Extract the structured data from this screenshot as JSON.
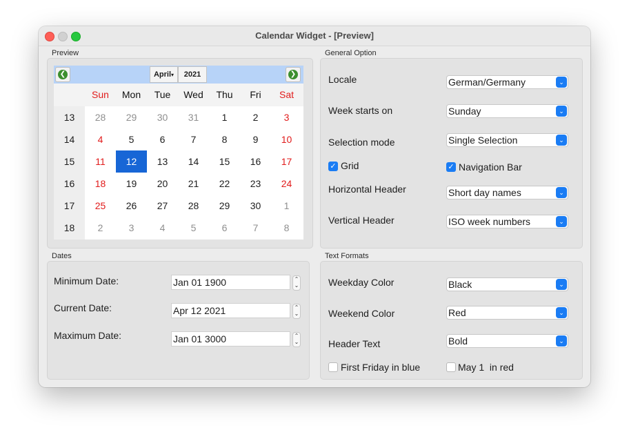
{
  "window": {
    "title": "Calendar Widget - [Preview]"
  },
  "preview": {
    "group_title": "Preview",
    "month": "April",
    "year": "2021",
    "day_headers": [
      {
        "label": "Sun",
        "weekend": true
      },
      {
        "label": "Mon",
        "weekend": false
      },
      {
        "label": "Tue",
        "weekend": false
      },
      {
        "label": "Wed",
        "weekend": false
      },
      {
        "label": "Thu",
        "weekend": false
      },
      {
        "label": "Fri",
        "weekend": false
      },
      {
        "label": "Sat",
        "weekend": true
      }
    ],
    "weeks": [
      {
        "week": "13",
        "days": [
          {
            "d": "28",
            "other": true
          },
          {
            "d": "29",
            "other": true
          },
          {
            "d": "30",
            "other": true
          },
          {
            "d": "31",
            "other": true
          },
          {
            "d": "1"
          },
          {
            "d": "2"
          },
          {
            "d": "3",
            "red": true
          }
        ]
      },
      {
        "week": "14",
        "days": [
          {
            "d": "4",
            "red": true
          },
          {
            "d": "5"
          },
          {
            "d": "6"
          },
          {
            "d": "7"
          },
          {
            "d": "8"
          },
          {
            "d": "9"
          },
          {
            "d": "10",
            "red": true
          }
        ]
      },
      {
        "week": "15",
        "days": [
          {
            "d": "11",
            "red": true
          },
          {
            "d": "12",
            "selected": true
          },
          {
            "d": "13"
          },
          {
            "d": "14"
          },
          {
            "d": "15"
          },
          {
            "d": "16"
          },
          {
            "d": "17",
            "red": true
          }
        ]
      },
      {
        "week": "16",
        "days": [
          {
            "d": "18",
            "red": true
          },
          {
            "d": "19"
          },
          {
            "d": "20"
          },
          {
            "d": "21"
          },
          {
            "d": "22"
          },
          {
            "d": "23"
          },
          {
            "d": "24",
            "red": true
          }
        ]
      },
      {
        "week": "17",
        "days": [
          {
            "d": "25",
            "red": true
          },
          {
            "d": "26"
          },
          {
            "d": "27"
          },
          {
            "d": "28"
          },
          {
            "d": "29"
          },
          {
            "d": "30"
          },
          {
            "d": "1",
            "other": true
          }
        ]
      },
      {
        "week": "18",
        "days": [
          {
            "d": "2",
            "other": true
          },
          {
            "d": "3",
            "other": true
          },
          {
            "d": "4",
            "other": true
          },
          {
            "d": "5",
            "other": true
          },
          {
            "d": "6",
            "other": true
          },
          {
            "d": "7",
            "other": true
          },
          {
            "d": "8",
            "other": true
          }
        ]
      }
    ]
  },
  "general": {
    "group_title": "General Option",
    "locale_label": "Locale",
    "locale_value": "German/Germany",
    "week_start_label": "Week starts on",
    "week_start_value": "Sunday",
    "selection_mode_label": "Selection mode",
    "selection_mode_value": "Single Selection",
    "grid_label": "Grid",
    "grid_checked": true,
    "navbar_label": "Navigation Bar",
    "navbar_checked": true,
    "hheader_label": "Horizontal Header",
    "hheader_value": "Short day names",
    "vheader_label": "Vertical Header",
    "vheader_value": "ISO week numbers"
  },
  "dates": {
    "group_title": "Dates",
    "min_label": "Minimum Date:",
    "min_value": "Jan 01 1900",
    "current_label": "Current Date:",
    "current_value": "Apr 12 2021",
    "max_label": "Maximum Date:",
    "max_value": "Jan 01 3000"
  },
  "text_formats": {
    "group_title": "Text Formats",
    "weekday_color_label": "Weekday Color",
    "weekday_color_value": "Black",
    "weekend_color_label": "Weekend Color",
    "weekend_color_value": "Red",
    "header_text_label": "Header Text",
    "header_text_value": "Bold",
    "first_friday_label": "First Friday in blue",
    "first_friday_checked": false,
    "may1_label": "May 1  in red",
    "may1_checked": false
  },
  "colors": {
    "accent": "#1a7cf4",
    "selected_day": "#1766d6",
    "weekend": "#e11b1b",
    "navbar": "#b7d3f8"
  },
  "icons": {
    "prev": "arrow-left-icon",
    "next": "arrow-right-icon",
    "dropdown": "chevron-down-icon",
    "checkmark": "checkmark-icon"
  }
}
